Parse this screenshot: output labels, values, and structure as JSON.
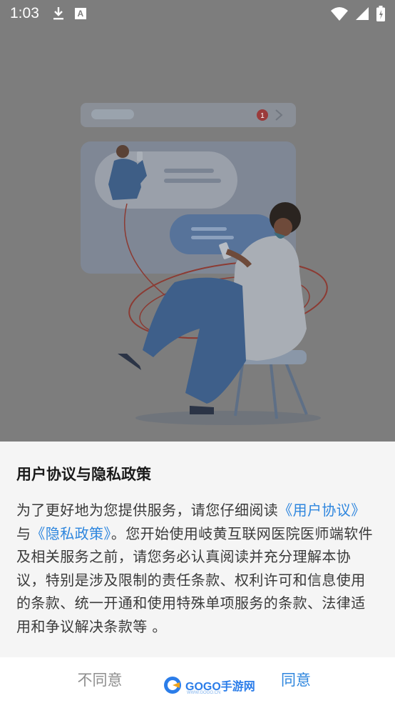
{
  "status_bar": {
    "time": "1:03",
    "icons": [
      "download-icon",
      "a-notification-icon",
      "wifi-icon",
      "signal-icon",
      "battery-icon"
    ]
  },
  "illustration": {
    "notification_badge": "1"
  },
  "dialog": {
    "title": "用户协议与隐私政策",
    "body_prefix": "为了更好地为您提供服务，请您仔细阅读",
    "link_user_agreement": "《用户协议》",
    "and_text": "与",
    "link_privacy_policy": "《隐私政策》",
    "body_suffix": "。您开始使用岐黄互联网医院医师端软件及相关服务之前，请您务必认真阅读并充分理解本协议，特别是涉及限制的责任条款、权利许可和信息使用的条款、统一开通和使用特殊单项服务的条款、法律适用和争议解决条款等 。",
    "disagree_label": "不同意",
    "agree_label": "同意"
  },
  "watermark": {
    "text": "GOGO手游网",
    "sub": "WWW.GOGO.CN"
  },
  "colors": {
    "link": "#2e86de",
    "overlay": "#7d7d7d"
  }
}
